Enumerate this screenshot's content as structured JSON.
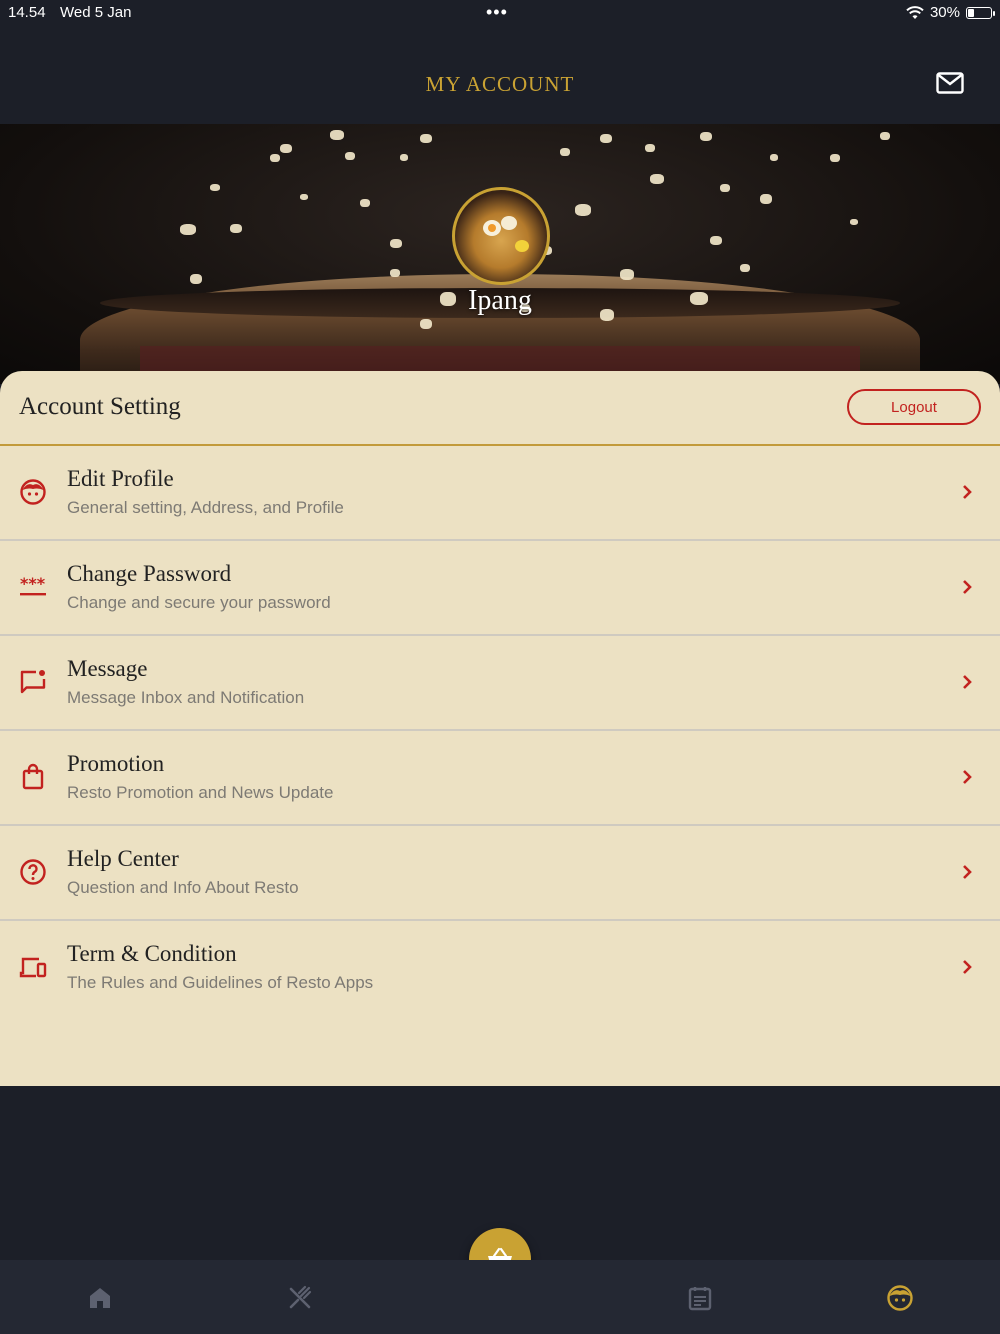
{
  "status_bar": {
    "time": "14.54",
    "date": "Wed 5 Jan",
    "battery_percent": "30%",
    "battery_level": 0.3
  },
  "header": {
    "title": "MY ACCOUNT",
    "mail_icon": "mail-icon"
  },
  "profile": {
    "name": "Ipang"
  },
  "account_setting": {
    "title": "Account Setting",
    "logout_label": "Logout"
  },
  "menu": [
    {
      "icon": "face-icon",
      "title": "Edit Profile",
      "subtitle": "General setting, Address, and Profile"
    },
    {
      "icon": "password-icon",
      "title": "Change Password",
      "subtitle": "Change and secure your password"
    },
    {
      "icon": "message-icon",
      "title": "Message",
      "subtitle": "Message Inbox and Notification"
    },
    {
      "icon": "shopping-bag-icon",
      "title": "Promotion",
      "subtitle": "Resto Promotion and News Update"
    },
    {
      "icon": "help-icon",
      "title": "Help Center",
      "subtitle": "Question and Info About Resto"
    },
    {
      "icon": "devices-icon",
      "title": "Term & Condition",
      "subtitle": "The Rules and Guidelines of Resto Apps"
    }
  ],
  "bottom_nav": {
    "items": [
      "home-icon",
      "cutlery-icon",
      "basket-icon",
      "calendar-icon",
      "face-icon"
    ],
    "active": "face-icon"
  },
  "colors": {
    "accent_gold": "#c9a233",
    "accent_red": "#c2221f",
    "panel_bg": "#ece1c3",
    "dark_bg": "#1c1f28",
    "nav_inactive": "#5d6170"
  }
}
